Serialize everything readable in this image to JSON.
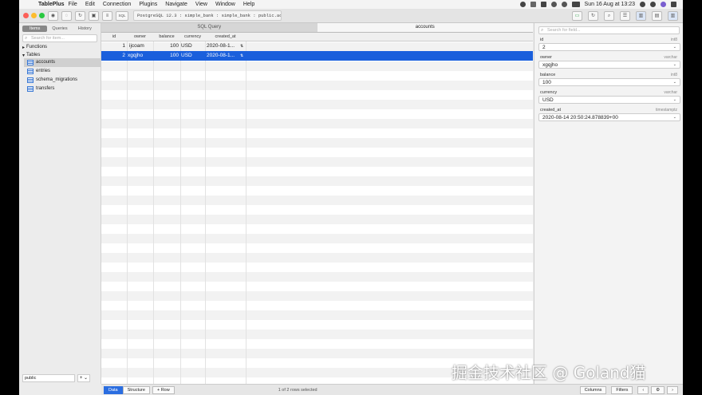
{
  "menubar": {
    "app_name": "TablePlus",
    "items": [
      "File",
      "Edit",
      "Connection",
      "Plugins",
      "Navigate",
      "View",
      "Window",
      "Help"
    ],
    "clock": "Sun 16 Aug at 13:23"
  },
  "toolbar": {
    "sql_label": "SQL",
    "connection": "PostgreSQL 12.3 : simple_bank : simple_bank : public.accounts"
  },
  "sidebar": {
    "tabs": [
      "Items",
      "Queries",
      "History"
    ],
    "search_placeholder": "Search for item...",
    "functions_label": "Functions",
    "tables_label": "Tables",
    "tables": [
      "accounts",
      "entries",
      "schema_migrations",
      "transfers"
    ],
    "schema": "public"
  },
  "tabs": [
    "SQL Query",
    "accounts"
  ],
  "grid": {
    "columns": [
      "id",
      "owner",
      "balance",
      "currency",
      "created_at"
    ],
    "rows": [
      [
        "1",
        "ijcoam",
        "100",
        "USD",
        "2020-08-1..."
      ],
      [
        "2",
        "xgqjho",
        "100",
        "USD",
        "2020-08-1..."
      ]
    ]
  },
  "detail": {
    "search_placeholder": "Search for field...",
    "fields": [
      {
        "name": "id",
        "type": "int8",
        "value": "2"
      },
      {
        "name": "owner",
        "type": "varchar",
        "value": "xgqjho"
      },
      {
        "name": "balance",
        "type": "int8",
        "value": "100"
      },
      {
        "name": "currency",
        "type": "varchar",
        "value": "USD"
      },
      {
        "name": "created_at",
        "type": "timestamptz",
        "value": "2020-08-14 20:50:24.878839+00"
      }
    ]
  },
  "status": {
    "data_label": "Data",
    "structure_label": "Structure",
    "row_label": "+ Row",
    "selection": "1 of 2 rows selected",
    "columns_label": "Columns",
    "filters_label": "Filters"
  },
  "watermark": "掘金技术社区 @ Goland猫",
  "colors": {
    "selection": "#1a5fdc",
    "accent": "#2a6de0"
  }
}
